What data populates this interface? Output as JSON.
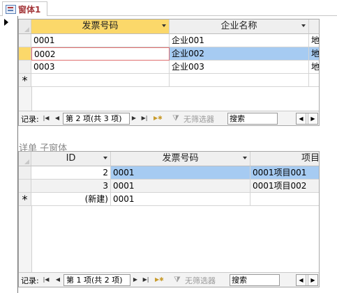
{
  "tab": {
    "title": "窗体1"
  },
  "main_grid": {
    "headers": [
      "发票号码",
      "企业名称",
      "地"
    ],
    "rows": [
      {
        "c1": "0001",
        "c2": "企业001",
        "c3": "地"
      },
      {
        "c1": "0002",
        "c2": "企业002",
        "c3": "地"
      },
      {
        "c1": "0003",
        "c2": "企业003",
        "c3": "地"
      }
    ],
    "new_row_marker": "*",
    "current_row_marker": "▌",
    "nav": {
      "label": "记录:",
      "record": "第 2 项(共 3 项)",
      "filter": "无筛选器",
      "search": "搜索"
    }
  },
  "subform": {
    "label": "详单  子窗体",
    "headers": [
      "ID",
      "发票号码",
      "项目"
    ],
    "rows": [
      {
        "id": "2",
        "inv": "0001",
        "item": "0001项目001"
      },
      {
        "id": "3",
        "inv": "0001",
        "item": "0001项目002"
      }
    ],
    "new_row": {
      "marker": "*",
      "id": "(新建)",
      "inv": "0001"
    },
    "nav": {
      "label": "记录:",
      "record": "第 1 项(共 2 项)",
      "filter": "无筛选器",
      "search": "搜索"
    }
  },
  "colors": {
    "highlight": "#a6cbf2",
    "active_header": "#fbd86a",
    "tab_text": "#a4373a",
    "edit_border": "#e07070"
  }
}
